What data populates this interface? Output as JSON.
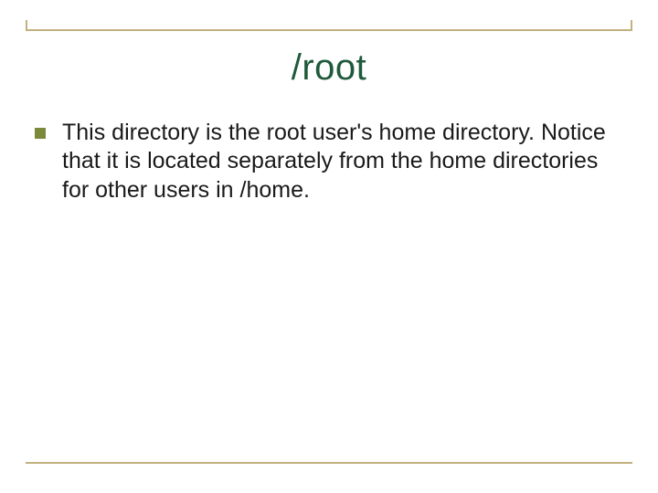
{
  "title": "/root",
  "bullets": [
    {
      "text": "This directory is the root user's home directory. Notice that it is located separately from the home directories for other users in /home."
    }
  ],
  "colors": {
    "rule": "#c2b280",
    "title": "#1f5a3a",
    "bullet_marker": "#7a8a3a",
    "body_text": "#1a1a1a"
  }
}
